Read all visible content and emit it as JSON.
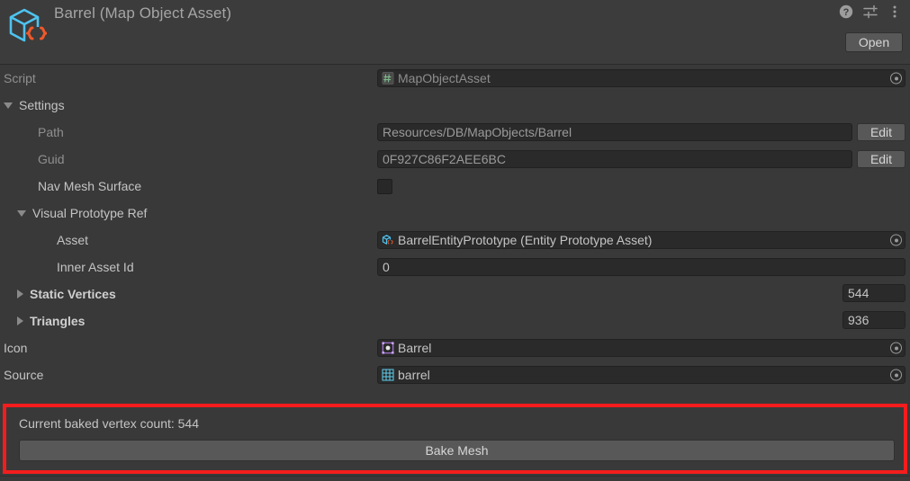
{
  "header": {
    "title": "Barrel (Map Object Asset)",
    "asset_icon": "scriptable-object-cube-icon",
    "help_icon": "help-icon",
    "preset_icon": "preset-sliders-icon",
    "menu_icon": "kebab-menu-icon",
    "open_label": "Open"
  },
  "script_row": {
    "label": "Script",
    "value": "MapObjectAsset",
    "icon": "csharp-script-icon"
  },
  "settings": {
    "label": "Settings",
    "expanded": true,
    "path": {
      "label": "Path",
      "value": "Resources/DB/MapObjects/Barrel",
      "edit_label": "Edit"
    },
    "guid": {
      "label": "Guid",
      "value": "0F927C86F2AEE6BC",
      "edit_label": "Edit"
    },
    "nav_mesh_surface": {
      "label": "Nav Mesh Surface",
      "checked": false
    },
    "visual_prototype_ref": {
      "label": "Visual Prototype Ref",
      "expanded": true,
      "asset": {
        "label": "Asset",
        "value": "BarrelEntityPrototype (Entity Prototype Asset)",
        "icon": "entity-prototype-cube-icon"
      },
      "inner_asset_id": {
        "label": "Inner Asset Id",
        "value": "0"
      }
    },
    "static_vertices": {
      "label": "Static Vertices",
      "expanded": false,
      "count": "544"
    },
    "triangles": {
      "label": "Triangles",
      "expanded": false,
      "count": "936"
    },
    "icon_row": {
      "label": "Icon",
      "value": "Barrel",
      "icon": "sprite-texture-icon"
    },
    "source_row": {
      "label": "Source",
      "value": "barrel",
      "icon": "mesh-grid-icon"
    }
  },
  "bake_panel": {
    "status": "Current baked vertex count: 544",
    "button_label": "Bake Mesh",
    "highlight_color": "#f41d1d"
  }
}
